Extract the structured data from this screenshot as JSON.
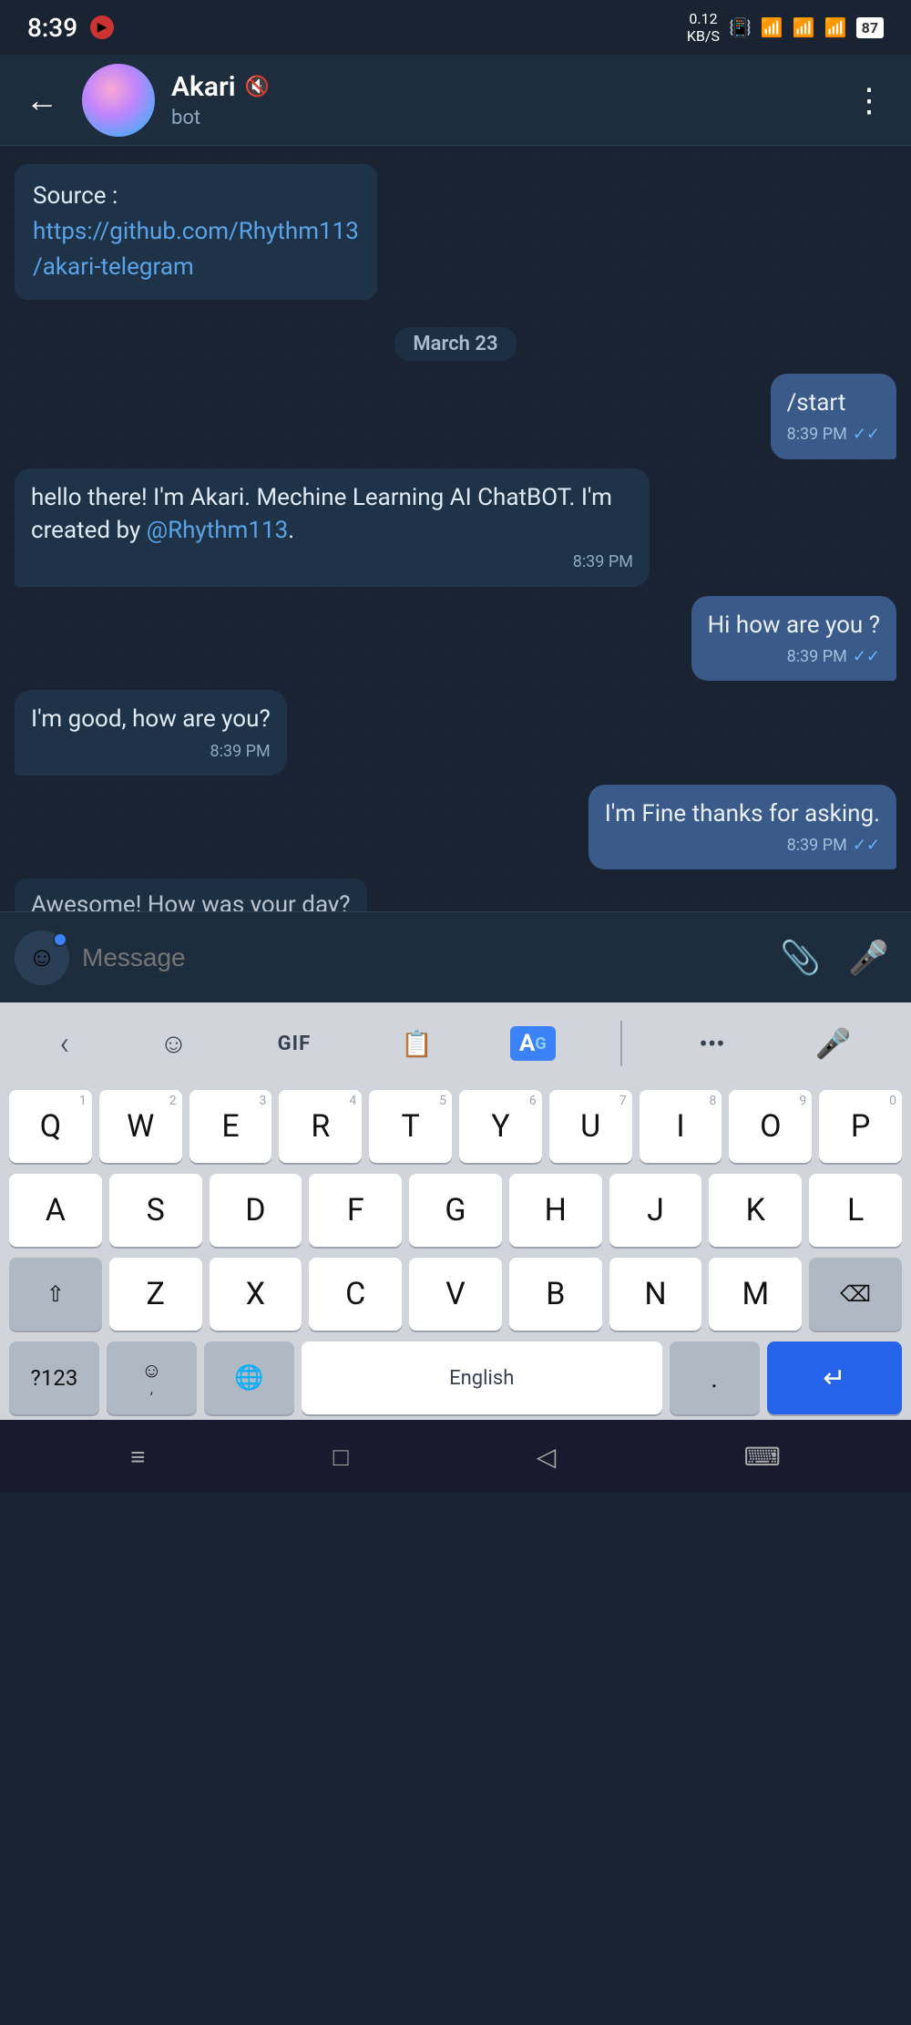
{
  "statusBar": {
    "time": "8:39",
    "battery": "87",
    "dataSpeed": "0.12\nKB/S"
  },
  "header": {
    "title": "Akari",
    "subtitle": "bot",
    "backLabel": "←",
    "moreLabel": "⋮"
  },
  "chat": {
    "dateSeparator": "March 23",
    "messages": [
      {
        "id": "msg0",
        "type": "incoming",
        "text": "Source :",
        "linkText": "https://github.com/Rhythm113/akari-telegram",
        "time": ""
      },
      {
        "id": "msg1",
        "type": "outgoing",
        "text": "/start",
        "time": "8:39 PM",
        "hasCheck": true
      },
      {
        "id": "msg2",
        "type": "incoming",
        "text": "hello there! I'm Akari. Mechine Learning AI ChatBOT. I'm created by @Rhythm113.",
        "time": "8:39 PM",
        "hasCheck": false
      },
      {
        "id": "msg3",
        "type": "outgoing",
        "text": "Hi how are you ?",
        "time": "8:39 PM",
        "hasCheck": true
      },
      {
        "id": "msg4",
        "type": "incoming",
        "text": "I'm good, how are you?",
        "time": "8:39 PM",
        "hasCheck": false
      },
      {
        "id": "msg5",
        "type": "outgoing",
        "text": "I'm Fine thanks for asking.",
        "time": "8:39 PM",
        "hasCheck": true
      },
      {
        "id": "msg6",
        "type": "incoming",
        "text": "Awesome! How was your day?",
        "time": "",
        "partial": true
      }
    ]
  },
  "messageBar": {
    "placeholder": "Message",
    "attachIcon": "📎",
    "micIcon": "🎤"
  },
  "keyboard": {
    "toolbar": {
      "backIcon": "‹",
      "emojiIcon": "☺",
      "gifLabel": "GIF",
      "clipboardIcon": "📋",
      "translateIcon": "A",
      "moreIcon": "•••",
      "micIcon": "🎤"
    },
    "rows": [
      [
        "Q",
        "W",
        "E",
        "R",
        "T",
        "Y",
        "U",
        "I",
        "O",
        "P"
      ],
      [
        "A",
        "S",
        "D",
        "F",
        "G",
        "H",
        "J",
        "K",
        "L"
      ],
      [
        "Z",
        "X",
        "C",
        "V",
        "B",
        "N",
        "M"
      ]
    ],
    "rowNumbers": [
      [
        "1",
        "2",
        "3",
        "4",
        "5",
        "6",
        "7",
        "8",
        "9",
        "0"
      ],
      [
        "",
        "",
        "",
        "",
        "",
        "",
        "",
        "",
        ""
      ],
      [
        "",
        "",
        "",
        "",
        "",
        "",
        ""
      ]
    ],
    "spaceLabel": "English",
    "numbersLabel": "?123",
    "deleteLabel": "⌫",
    "shiftLabel": "⇧",
    "emojiKeyLabel": "☺",
    "globeKeyLabel": "🌐",
    "periodLabel": ".",
    "enterLabel": "↵"
  },
  "bottomNav": {
    "menuIcon": "≡",
    "homeIcon": "□",
    "backIcon": "◁",
    "keyboardIcon": "⌨"
  }
}
